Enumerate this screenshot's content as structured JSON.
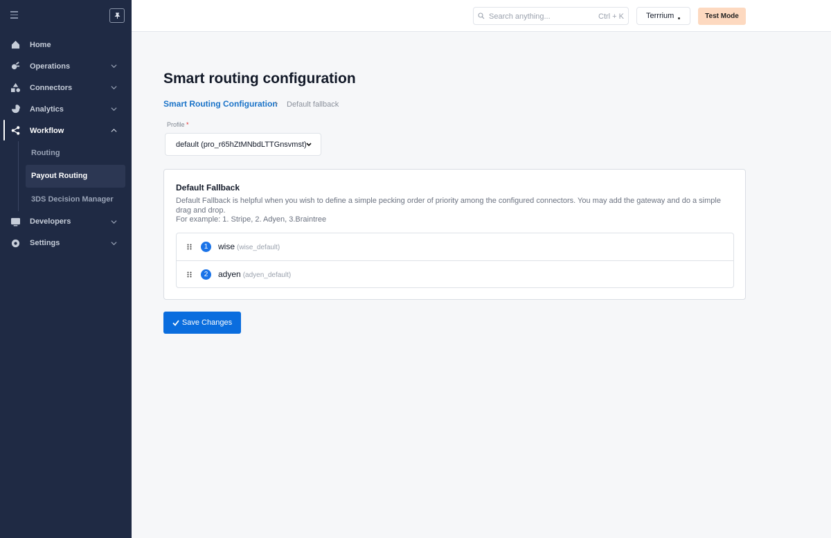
{
  "sidebar": {
    "items": [
      {
        "label": "Home"
      },
      {
        "label": "Operations"
      },
      {
        "label": "Connectors"
      },
      {
        "label": "Analytics"
      },
      {
        "label": "Workflow"
      },
      {
        "label": "Developers"
      },
      {
        "label": "Settings"
      }
    ],
    "workflow_sub": [
      {
        "label": "Routing"
      },
      {
        "label": "Payout Routing"
      },
      {
        "label": "3DS Decision Manager"
      }
    ]
  },
  "header": {
    "search_placeholder": "Search anything...",
    "search_shortcut": "Ctrl + K",
    "merchant": "Terrrium",
    "mode": "Test Mode"
  },
  "main": {
    "title": "Smart routing configuration",
    "breadcrumb": {
      "link": "Smart Routing Configuration",
      "current": "Default fallback"
    },
    "profile": {
      "label": "Profile",
      "required_mark": "*",
      "value": "default (pro_r65hZtMNbdLTTGnsvmst)"
    },
    "card": {
      "title": "Default Fallback",
      "description": "Default Fallback is helpful when you wish to define a simple pecking order of priority among the configured connectors. You may add the gateway and do a simple drag and drop.",
      "example": "For example: 1. Stripe, 2. Adyen, 3.Braintree",
      "connectors": [
        {
          "index": "1",
          "name": "wise",
          "label": "(wise_default)"
        },
        {
          "index": "2",
          "name": "adyen",
          "label": "(adyen_default)"
        }
      ]
    },
    "save_label": "Save Changes"
  },
  "colors": {
    "sidebar_bg": "#1f2a44",
    "primary": "#0a6dde",
    "link": "#1a73c8",
    "test_mode_bg": "#fdd9c0"
  }
}
